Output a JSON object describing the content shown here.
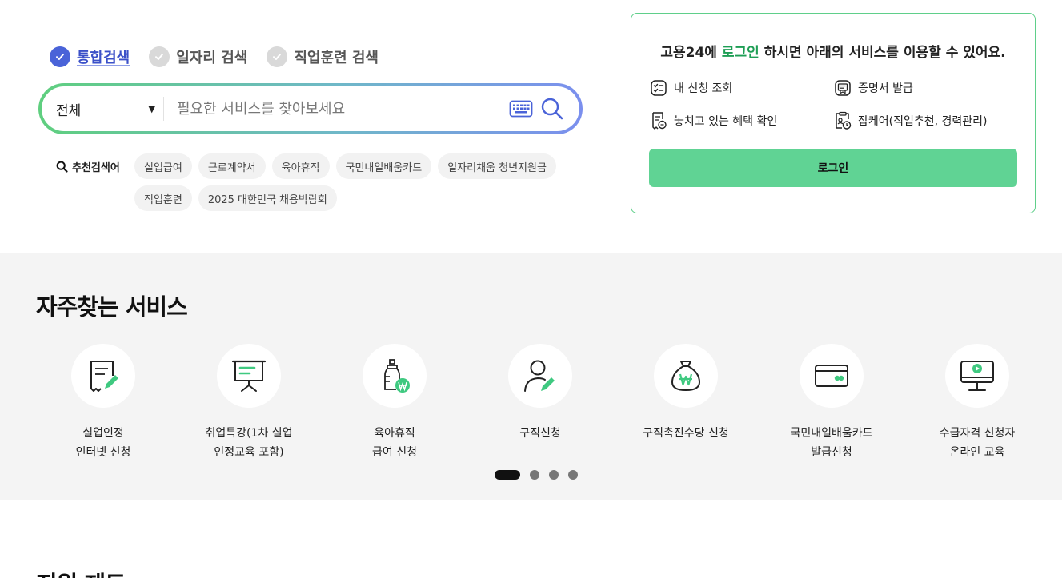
{
  "search": {
    "tabs": [
      {
        "label": "통합검색",
        "active": true
      },
      {
        "label": "일자리 검색",
        "active": false
      },
      {
        "label": "직업훈련 검색",
        "active": false
      }
    ],
    "category_value": "전체",
    "placeholder": "필요한 서비스를 찾아보세요",
    "accent_colors": [
      "#5fcf7f",
      "#7b8fee"
    ]
  },
  "recommended": {
    "title": "추천검색어",
    "keywords": [
      "실업급여",
      "근로계약서",
      "육아휴직",
      "국민내일배움카드",
      "일자리채움 청년지원금",
      "직업훈련",
      "2025 대한민국 채용박람회"
    ]
  },
  "login_panel": {
    "message_prefix": "고용24에 ",
    "message_link": "로그인",
    "message_suffix": " 하시면 아래의 서비스를 이용할 수 있어요.",
    "services": [
      {
        "label": "내 신청 조회",
        "icon": "checklist-icon"
      },
      {
        "label": "증명서 발급",
        "icon": "certificate-icon"
      },
      {
        "label": "놓치고 있는 혜택 확인",
        "icon": "benefit-doc-icon"
      },
      {
        "label": "잡케어(직업추천, 경력관리)",
        "icon": "jobcare-clipboard-icon"
      }
    ],
    "login_button": "로그인",
    "accent_color": "#60d394"
  },
  "frequent": {
    "title": "자주찾는 서비스",
    "items": [
      {
        "label": "실업인정\n인터넷 신청",
        "icon": "document-pen-icon"
      },
      {
        "label": "취업특강(1차 실업\n인정교육 포함)",
        "icon": "presentation-board-icon"
      },
      {
        "label": "육아휴직\n급여 신청",
        "icon": "baby-bottle-won-icon"
      },
      {
        "label": "구직신청",
        "icon": "person-pen-icon"
      },
      {
        "label": "구직촉진수당 신청",
        "icon": "money-bag-won-icon"
      },
      {
        "label": "국민내일배움카드\n발급신청",
        "icon": "card-icon"
      },
      {
        "label": "수급자격 신청자\n온라인 교육",
        "icon": "monitor-play-icon"
      }
    ],
    "pager": {
      "total": 4,
      "current": 1
    }
  },
  "next_section": {
    "title": "지원 제도"
  }
}
